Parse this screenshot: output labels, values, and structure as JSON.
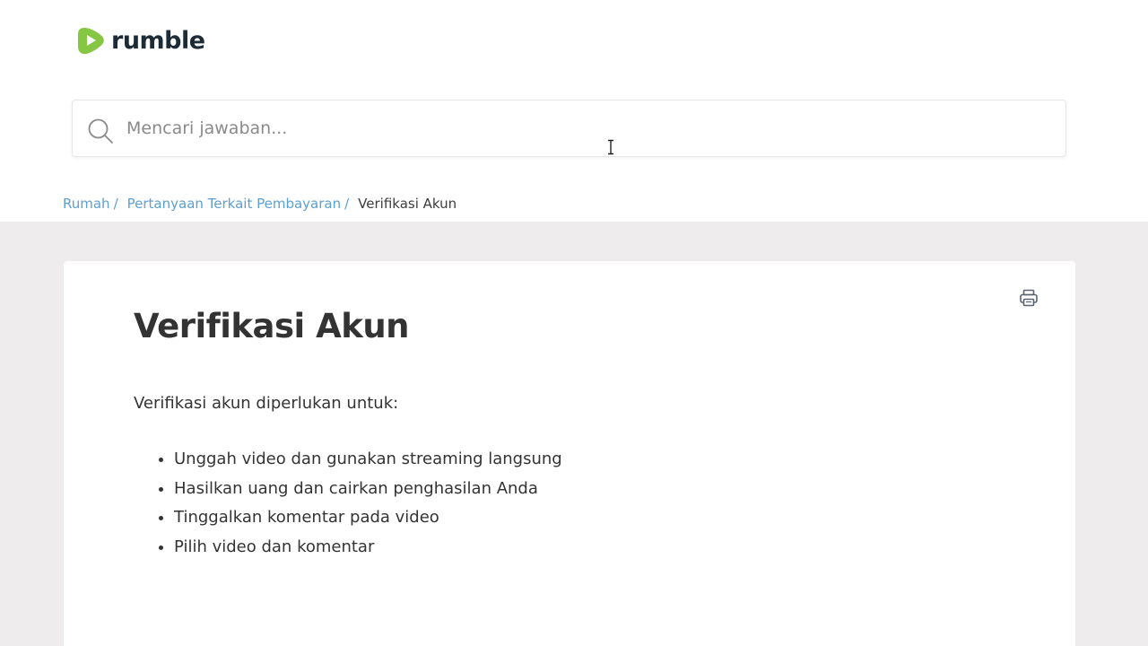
{
  "header": {
    "logo_text": "rumble"
  },
  "search": {
    "placeholder": "Mencari jawaban..."
  },
  "breadcrumb": {
    "items": [
      {
        "label": "Rumah",
        "separator": "/"
      },
      {
        "label": "Pertanyaan Terkait Pembayaran",
        "separator": "/"
      }
    ],
    "current": "Verifikasi Akun"
  },
  "article": {
    "title": "Verifikasi Akun",
    "intro": "Verifikasi akun diperlukan untuk:",
    "list_items": [
      "Unggah video dan gunakan streaming langsung",
      "Hasilkan uang dan cairkan penghasilan Anda",
      "Tinggalkan komentar pada video",
      "Pilih video dan komentar"
    ]
  },
  "colors": {
    "brand_green": "#85c742",
    "link_blue": "#5c9fd1",
    "text_dark": "#333333",
    "page_gray": "#eeecec"
  }
}
